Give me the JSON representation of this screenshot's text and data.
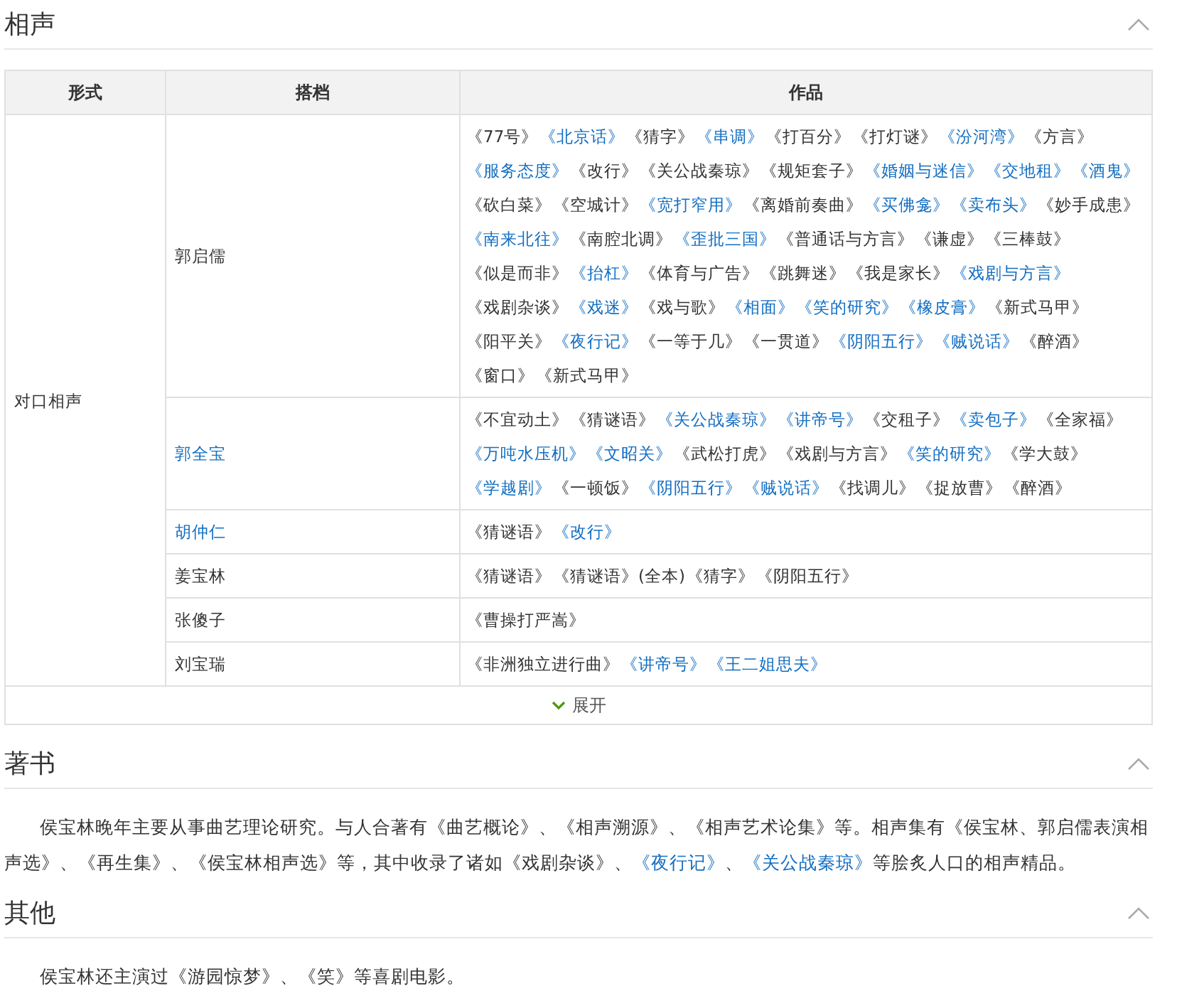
{
  "sections": [
    {
      "title": "相声",
      "expanded": true,
      "kind": "table",
      "table": {
        "columns": [
          "形式",
          "搭档",
          "作品"
        ],
        "form": "对口相声",
        "rows": [
          {
            "partner": "郭启儒",
            "link": false,
            "works": [
              {
                "t": "《77号》",
                "link": false
              },
              {
                "t": "《北京话》",
                "link": true
              },
              {
                "t": "《猜字》",
                "link": false
              },
              {
                "t": "《串调》",
                "link": true
              },
              {
                "t": "《打百分》",
                "link": false
              },
              {
                "t": "《打灯谜》",
                "link": false
              },
              {
                "t": "《汾河湾》",
                "link": true
              },
              {
                "t": "《方言》",
                "link": false
              },
              {
                "t": "《服务态度》",
                "link": true
              },
              {
                "t": "《改行》",
                "link": false
              },
              {
                "t": "《关公战秦琼》",
                "link": false
              },
              {
                "t": "《规矩套子》",
                "link": false
              },
              {
                "t": "《婚姻与迷信》",
                "link": true
              },
              {
                "t": "《交地租》",
                "link": true
              },
              {
                "t": "《酒鬼》",
                "link": true
              },
              {
                "t": "《砍白菜》",
                "link": false
              },
              {
                "t": "《空城计》",
                "link": false
              },
              {
                "t": "《宽打窄用》",
                "link": true
              },
              {
                "t": "《离婚前奏曲》",
                "link": false
              },
              {
                "t": "《买佛龛》",
                "link": true
              },
              {
                "t": "《卖布头》",
                "link": true
              },
              {
                "t": "《妙手成患》",
                "link": false
              },
              {
                "t": "《南来北往》",
                "link": true
              },
              {
                "t": "《南腔北调》",
                "link": false
              },
              {
                "t": "《歪批三国》",
                "link": true
              },
              {
                "t": "《普通话与方言》",
                "link": false
              },
              {
                "t": "《谦虚》",
                "link": false
              },
              {
                "t": "《三棒鼓》",
                "link": false
              },
              {
                "t": "《似是而非》",
                "link": false
              },
              {
                "t": "《抬杠》",
                "link": true
              },
              {
                "t": "《体育与广告》",
                "link": false
              },
              {
                "t": "《跳舞迷》",
                "link": false
              },
              {
                "t": "《我是家长》",
                "link": false
              },
              {
                "t": "《戏剧与方言》",
                "link": true
              },
              {
                "t": "《戏剧杂谈》",
                "link": false
              },
              {
                "t": "《戏迷》",
                "link": true
              },
              {
                "t": "《戏与歌》",
                "link": false
              },
              {
                "t": "《相面》",
                "link": true
              },
              {
                "t": "《笑的研究》",
                "link": true
              },
              {
                "t": "《橡皮膏》",
                "link": true
              },
              {
                "t": "《新式马甲》",
                "link": false
              },
              {
                "t": "《阳平关》",
                "link": false
              },
              {
                "t": "《夜行记》",
                "link": true
              },
              {
                "t": "《一等于几》",
                "link": false
              },
              {
                "t": "《一贯道》",
                "link": false
              },
              {
                "t": "《阴阳五行》",
                "link": true
              },
              {
                "t": "《贼说话》",
                "link": true
              },
              {
                "t": "《醉酒》",
                "link": false
              },
              {
                "t": "《窗口》",
                "link": false
              },
              {
                "t": "《新式马甲》",
                "link": false
              }
            ]
          },
          {
            "partner": "郭全宝",
            "link": true,
            "works": [
              {
                "t": "《不宜动土》",
                "link": false
              },
              {
                "t": "《猜谜语》",
                "link": false
              },
              {
                "t": "《关公战秦琼》",
                "link": true
              },
              {
                "t": "《讲帝号》",
                "link": true
              },
              {
                "t": "《交租子》",
                "link": false
              },
              {
                "t": "《卖包子》",
                "link": true
              },
              {
                "t": "《全家福》",
                "link": false
              },
              {
                "t": "《万吨水压机》",
                "link": true
              },
              {
                "t": "《文昭关》",
                "link": true
              },
              {
                "t": "《武松打虎》",
                "link": false
              },
              {
                "t": "《戏剧与方言》",
                "link": false
              },
              {
                "t": "《笑的研究》",
                "link": true
              },
              {
                "t": "《学大鼓》",
                "link": false
              },
              {
                "t": "《学越剧》",
                "link": true
              },
              {
                "t": "《一顿饭》",
                "link": false
              },
              {
                "t": "《阴阳五行》",
                "link": true
              },
              {
                "t": "《贼说话》",
                "link": true
              },
              {
                "t": "《找调儿》",
                "link": false
              },
              {
                "t": "《捉放曹》",
                "link": false
              },
              {
                "t": "《醉酒》",
                "link": false
              }
            ]
          },
          {
            "partner": "胡仲仁",
            "link": true,
            "works": [
              {
                "t": "《猜谜语》",
                "link": false
              },
              {
                "t": "《改行》",
                "link": true
              }
            ]
          },
          {
            "partner": "姜宝林",
            "link": false,
            "works": [
              {
                "t": "《猜谜语》",
                "link": false
              },
              {
                "t": "《猜谜语》(全本)",
                "link": false
              },
              {
                "t": "《猜字》",
                "link": false
              },
              {
                "t": "《阴阳五行》",
                "link": false
              }
            ]
          },
          {
            "partner": "张傻子",
            "link": false,
            "works": [
              {
                "t": "《曹操打严嵩》",
                "link": false
              }
            ]
          },
          {
            "partner": "刘宝瑞",
            "link": false,
            "works": [
              {
                "t": "《非洲独立进行曲》",
                "link": false
              },
              {
                "t": "《讲帝号》",
                "link": true
              },
              {
                "t": "《王二姐思夫》",
                "link": true
              }
            ]
          }
        ],
        "more_button": "展开"
      }
    },
    {
      "title": "著书",
      "expanded": true,
      "kind": "text",
      "paragraph": [
        {
          "t": "侯宝林晚年主要从事曲艺理论研究。与人合著有《曲艺概论》、《相声溯源》、《相声艺术论集》等。相声集有《侯宝林、郭启儒表演相声选》、《再生集》、《侯宝林相声选》等，其中收录了诸如《戏剧杂谈》、",
          "link": false
        },
        {
          "t": "《夜行记》",
          "link": true
        },
        {
          "t": "、",
          "link": false
        },
        {
          "t": "《关公战秦琼》",
          "link": true
        },
        {
          "t": "等脍炙人口的相声精品。",
          "link": false
        }
      ]
    },
    {
      "title": "其他",
      "expanded": true,
      "kind": "text",
      "paragraph": [
        {
          "t": "侯宝林还主演过《游园惊梦》、《笑》等喜剧电影。",
          "link": false
        }
      ]
    }
  ]
}
